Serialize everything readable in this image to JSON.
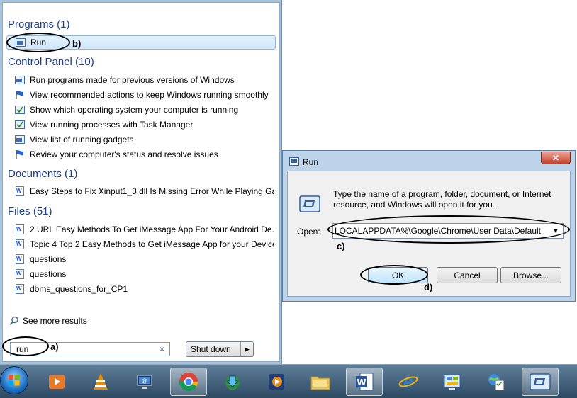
{
  "start_menu": {
    "groups": {
      "programs": "Programs (1)",
      "control_panel": "Control Panel (10)",
      "documents": "Documents (1)",
      "files": "Files (51)"
    },
    "programs": [
      {
        "label": "Run",
        "icon": "run-icon",
        "highlighted": true
      }
    ],
    "control_panel": [
      {
        "label": "Run programs made for previous versions of Windows",
        "icon": "window-icon"
      },
      {
        "label": "View recommended actions to keep Windows running smoothly",
        "icon": "flag-icon"
      },
      {
        "label": "Show which operating system your computer is running",
        "icon": "window-check-icon"
      },
      {
        "label": "View running processes with Task Manager",
        "icon": "window-check-icon"
      },
      {
        "label": "View list of running gadgets",
        "icon": "window-icon"
      },
      {
        "label": "Review your computer's status and resolve issues",
        "icon": "flag-icon"
      }
    ],
    "documents": [
      {
        "label": "Easy Steps to Fix Xinput1_3.dll Is Missing Error While Playing Ga...",
        "icon": "word-doc-icon"
      }
    ],
    "files": [
      {
        "label": "2 URL Easy Methods To Get iMessage App For Your Android De...",
        "icon": "word-doc-icon"
      },
      {
        "label": "Topic 4 Top 2 Easy Methods to Get iMessage App for your Device",
        "icon": "word-doc-icon"
      },
      {
        "label": "questions",
        "icon": "word-doc-icon"
      },
      {
        "label": "questions",
        "icon": "word-doc-icon"
      },
      {
        "label": "dbms_questions_for_CP1",
        "icon": "word-doc-icon"
      }
    ],
    "see_more": "See more results",
    "search_value": "run",
    "search_clear": "×",
    "shutdown_label": "Shut down",
    "shutdown_arrow": "▶"
  },
  "run_dialog": {
    "title": "Run",
    "close": "✕",
    "description": "Type the name of a program, folder, document, or Internet resource, and Windows will open it for you.",
    "open_label": "Open:",
    "open_value": "LOCALAPPDATA%\\Google\\Chrome\\User Data\\Default",
    "ok_label": "OK",
    "cancel_label": "Cancel",
    "browse_label": "Browse..."
  },
  "annotations": {
    "a": "a)",
    "b": "b)",
    "c": "c)",
    "d": "d)"
  },
  "taskbar": {
    "items": [
      "media-player-icon",
      "vlc-icon",
      "network-computer-icon",
      "chrome-icon",
      "download-manager-icon",
      "media-app-icon",
      "explorer-folder-icon",
      "word-icon",
      "internet-explorer-icon",
      "control-panel-icon",
      "globe-checklist-icon",
      "run-icon"
    ],
    "active": [
      "chrome-icon",
      "word-icon",
      "run-icon"
    ]
  },
  "colors": {
    "group_heading": "#1e3f8a",
    "taskbar": "#2d4a63",
    "dialog_frame": "#bcd3ea"
  }
}
